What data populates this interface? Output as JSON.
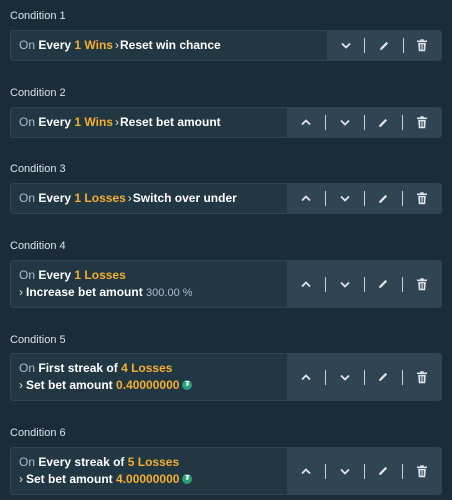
{
  "conditions": [
    {
      "label": "Condition 1",
      "line1": {
        "on": "On",
        "pre": "Every",
        "highlight": "1 Wins"
      },
      "action_inline": "Reset win chance",
      "buttons": [
        "down",
        "edit",
        "delete"
      ]
    },
    {
      "label": "Condition 2",
      "line1": {
        "on": "On",
        "pre": "Every",
        "highlight": "1 Wins"
      },
      "action_inline": "Reset bet amount",
      "buttons": [
        "up",
        "down",
        "edit",
        "delete"
      ]
    },
    {
      "label": "Condition 3",
      "line1": {
        "on": "On",
        "pre": "Every",
        "highlight": "1 Losses"
      },
      "action_inline": "Switch over under",
      "buttons": [
        "up",
        "down",
        "edit",
        "delete"
      ]
    },
    {
      "label": "Condition 4",
      "line1": {
        "on": "On",
        "pre": "Every",
        "highlight": "1 Losses"
      },
      "action": "Increase bet amount",
      "action_value": "300.00 %",
      "buttons": [
        "up",
        "down",
        "edit",
        "delete"
      ]
    },
    {
      "label": "Condition 5",
      "line1": {
        "on": "On",
        "pre": "First streak of",
        "highlight": "4 Losses"
      },
      "action": "Set bet amount",
      "action_amount": "0.40000000",
      "token_icon": "tether-icon",
      "buttons": [
        "up",
        "down",
        "edit",
        "delete"
      ]
    },
    {
      "label": "Condition 6",
      "line1": {
        "on": "On",
        "pre": "Every streak of",
        "highlight": "5 Losses"
      },
      "action": "Set bet amount",
      "action_amount": "4.00000000",
      "token_icon": "tether-icon",
      "buttons": [
        "up",
        "down",
        "edit",
        "delete"
      ]
    }
  ],
  "colors": {
    "background": "#1a2c38",
    "row": "#213743",
    "action_panel": "#2f4553",
    "highlight": "#f5ae30",
    "token": "#26a17b"
  }
}
